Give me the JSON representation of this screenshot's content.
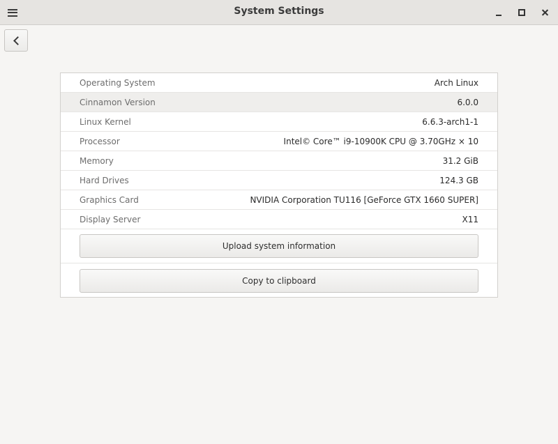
{
  "window": {
    "title": "System Settings"
  },
  "icons": {
    "menu": "hamburger-menu-icon",
    "minimize": "minimize-icon",
    "maximize": "maximize-icon",
    "close": "close-icon",
    "back": "chevron-left-icon"
  },
  "info": [
    {
      "label": "Operating System",
      "value": "Arch Linux"
    },
    {
      "label": "Cinnamon Version",
      "value": "6.0.0"
    },
    {
      "label": "Linux Kernel",
      "value": "6.6.3-arch1-1"
    },
    {
      "label": "Processor",
      "value": "Intel© Core™ i9-10900K CPU @ 3.70GHz × 10"
    },
    {
      "label": "Memory",
      "value": "31.2 GiB"
    },
    {
      "label": "Hard Drives",
      "value": "124.3 GB"
    },
    {
      "label": "Graphics Card",
      "value": "NVIDIA Corporation TU116 [GeForce GTX 1660 SUPER]"
    },
    {
      "label": "Display Server",
      "value": "X11"
    }
  ],
  "actions": {
    "upload_label": "Upload system information",
    "copy_label": "Copy to clipboard"
  },
  "colors": {
    "titlebar": "#e6e4e1",
    "window_bg": "#f6f5f3",
    "panel_bg": "#ffffff",
    "highlight_row": "#efeeec"
  }
}
